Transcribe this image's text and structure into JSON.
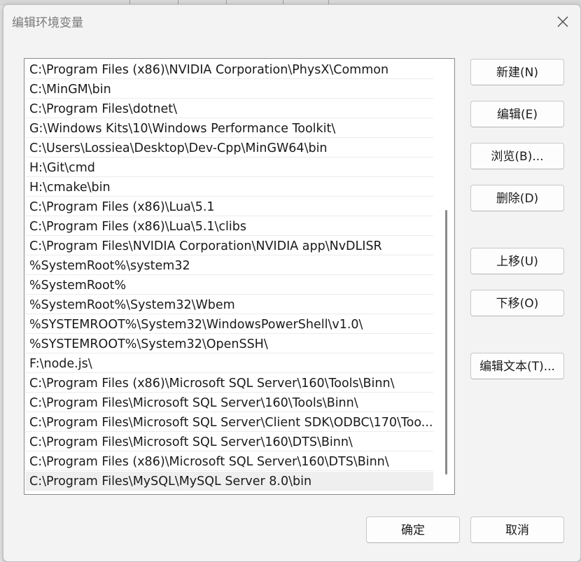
{
  "dialog": {
    "title": "编辑环境变量"
  },
  "paths": [
    "C:\\Program Files (x86)\\NVIDIA Corporation\\PhysX\\Common",
    "C:\\MinGM\\bin",
    "C:\\Program Files\\dotnet\\",
    "G:\\Windows Kits\\10\\Windows Performance Toolkit\\",
    "C:\\Users\\Lossiea\\Desktop\\Dev-Cpp\\MinGW64\\bin",
    "H:\\Git\\cmd",
    "H:\\cmake\\bin",
    "C:\\Program Files (x86)\\Lua\\5.1",
    "C:\\Program Files (x86)\\Lua\\5.1\\clibs",
    "C:\\Program Files\\NVIDIA Corporation\\NVIDIA app\\NvDLISR",
    "%SystemRoot%\\system32",
    "%SystemRoot%",
    "%SystemRoot%\\System32\\Wbem",
    "%SYSTEMROOT%\\System32\\WindowsPowerShell\\v1.0\\",
    "%SYSTEMROOT%\\System32\\OpenSSH\\",
    "F:\\node.js\\",
    "C:\\Program Files (x86)\\Microsoft SQL Server\\160\\Tools\\Binn\\",
    "C:\\Program Files\\Microsoft SQL Server\\160\\Tools\\Binn\\",
    "C:\\Program Files\\Microsoft SQL Server\\Client SDK\\ODBC\\170\\Too...",
    "C:\\Program Files\\Microsoft SQL Server\\160\\DTS\\Binn\\",
    "C:\\Program Files (x86)\\Microsoft SQL Server\\160\\DTS\\Binn\\",
    "C:\\Program Files\\MySQL\\MySQL Server 8.0\\bin"
  ],
  "selected_index": 21,
  "buttons": {
    "new": "新建(N)",
    "edit": "编辑(E)",
    "browse": "浏览(B)...",
    "delete": "删除(D)",
    "move_up": "上移(U)",
    "move_down": "下移(O)",
    "edit_text": "编辑文本(T)...",
    "ok": "确定",
    "cancel": "取消"
  }
}
